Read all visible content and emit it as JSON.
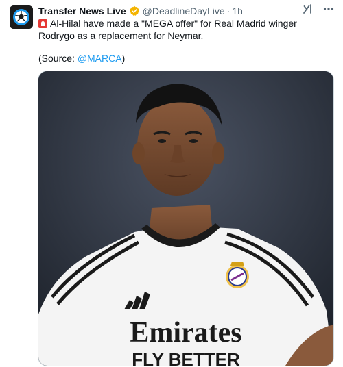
{
  "tweet": {
    "author_name": "Transfer News Live",
    "handle": "@DeadlineDayLive",
    "separator": "·",
    "time": "1h",
    "text_line": "Al-Hilal have made a \"MEGA offer\" for Real Madrid winger Rodrygo as a replacement for Neymar.",
    "source_prefix": "(Source: ",
    "source_mention": "@MARCA",
    "source_suffix": ")",
    "icons": {
      "avatar": "soccer-ball-avatar-icon",
      "verified": "verified-badge-icon",
      "alert": "siren-emoji-icon",
      "grok": "grok-icon",
      "more": "more-options-icon"
    },
    "colors": {
      "verified_badge": "#f4b400",
      "link": "#1d9bf0",
      "secondary_text": "#536471"
    }
  },
  "media": {
    "jersey_sponsor": "Emirates",
    "jersey_sponsor_line2": "FLY BETTER"
  }
}
